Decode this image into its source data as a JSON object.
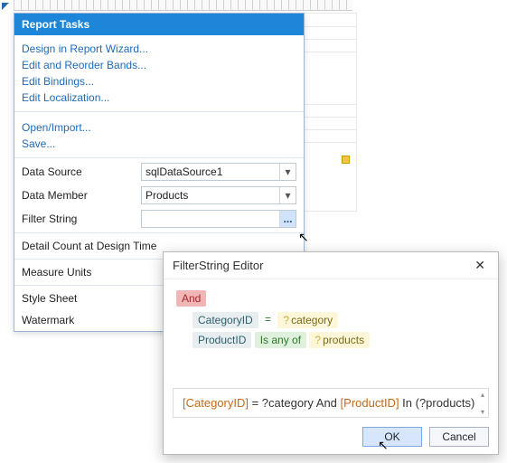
{
  "panel": {
    "title": "Report Tasks",
    "links_top": [
      "Design in Report Wizard...",
      "Edit and Reorder Bands...",
      "Edit Bindings...",
      "Edit Localization..."
    ],
    "links_mid": [
      "Open/Import...",
      "Save..."
    ],
    "props": {
      "data_source": {
        "label": "Data Source",
        "value": "sqlDataSource1"
      },
      "data_member": {
        "label": "Data Member",
        "value": "Products"
      },
      "filter_string": {
        "label": "Filter String",
        "value": ""
      },
      "detail_count": {
        "label": "Detail Count at Design Time"
      },
      "measure_units": {
        "label": "Measure Units"
      },
      "style_sheet": {
        "label": "Style Sheet"
      },
      "watermark": {
        "label": "Watermark"
      }
    },
    "ellipsis": "..."
  },
  "dialog": {
    "title": "FilterString Editor",
    "root_op": "And",
    "rows": [
      {
        "field": "CategoryID",
        "op_text": "=",
        "param": "category",
        "op_kind": "eq"
      },
      {
        "field": "ProductID",
        "op_text": "Is any of",
        "param": "products",
        "op_kind": "pill"
      }
    ],
    "expression_parts": {
      "f1": "[CategoryID]",
      "t1": " = ?category And ",
      "f2": "[ProductID]",
      "t2": " In (?products)"
    },
    "ok": "OK",
    "cancel": "Cancel",
    "close": "✕",
    "param_glyph": "?"
  }
}
